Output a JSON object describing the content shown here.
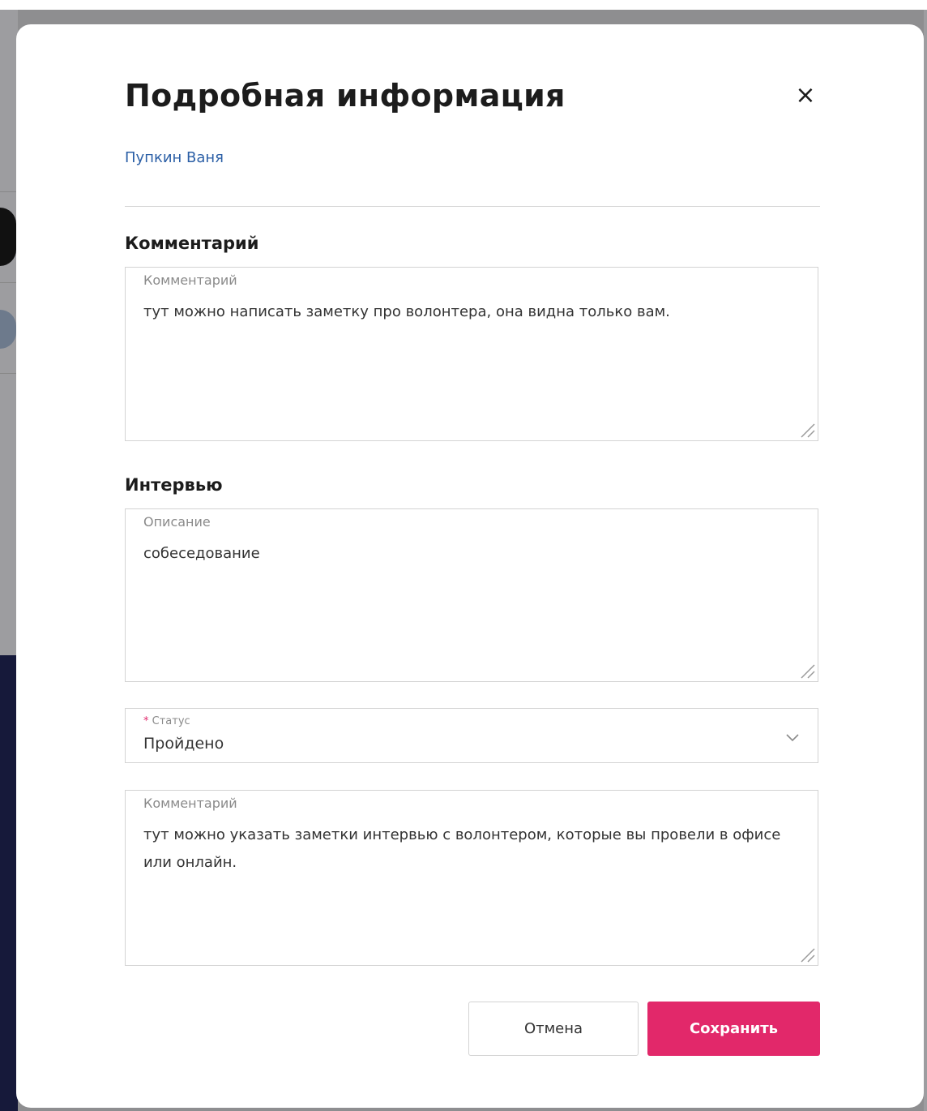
{
  "modal": {
    "title": "Подробная информация",
    "close_icon": "close-icon",
    "close_glyph": "×",
    "volunteer_name": "Пупкин Ваня"
  },
  "comment_section": {
    "heading": "Комментарий",
    "field_label": "Комментарий",
    "field_value": "тут можно написать заметку про волонтера, она видна только вам."
  },
  "interview_section": {
    "heading": "Интервью",
    "description_label": "Описание",
    "description_value": "собеседование",
    "status_required_mark": "*",
    "status_label": "Статус",
    "status_value": "Пройдено",
    "status_icon": "chevron-down-icon",
    "comment_label": "Комментарий",
    "comment_value": "тут можно указать заметки интервью с волонтером, которые вы провели в офисе или онлайн."
  },
  "actions": {
    "cancel_label": "Отмена",
    "save_label": "Сохранить"
  },
  "colors": {
    "accent": "#e2286a",
    "link": "#2b5fa6"
  }
}
